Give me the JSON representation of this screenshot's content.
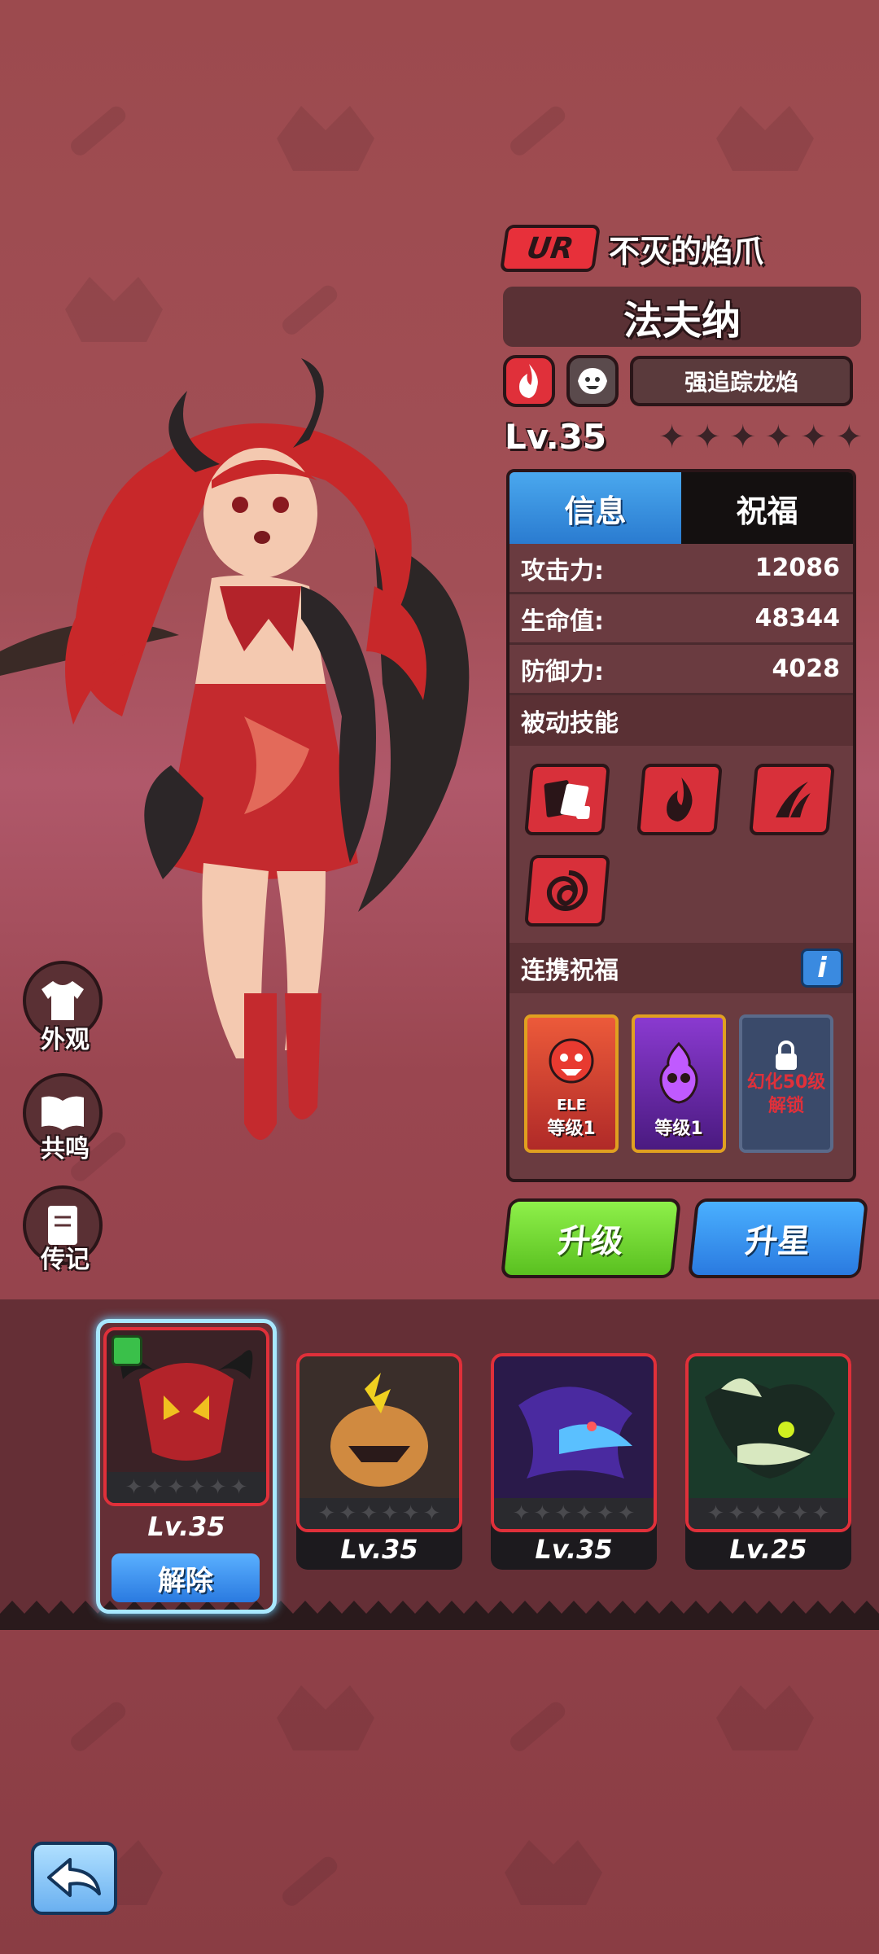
{
  "hero": {
    "rarity": "UR",
    "subtitle": "不灭的焰爪",
    "name": "法夫纳",
    "element_icons": [
      "fire-icon",
      "beast-icon"
    ],
    "trait": "强追踪龙焰",
    "level": "Lv.35",
    "stars_total": 6,
    "stars_filled": 0
  },
  "tabs": {
    "info": "信息",
    "bless": "祝福",
    "active": "info"
  },
  "stats": [
    {
      "label": "攻击力:",
      "value": "12086"
    },
    {
      "label": "生命值:",
      "value": "48344"
    },
    {
      "label": "防御力:",
      "value": "4028"
    }
  ],
  "passive": {
    "title": "被动技能",
    "skills": [
      "cards-dice-icon",
      "flame-icon",
      "claw-slash-icon",
      "swirl-icon"
    ]
  },
  "bond": {
    "title": "连携祝福",
    "info_label": "i",
    "cards": [
      {
        "tag": "ELE",
        "level": "等级1"
      },
      {
        "level": "等级1"
      }
    ],
    "locked": {
      "line1": "幻化50级",
      "line2": "解锁"
    }
  },
  "actions": {
    "upgrade": "升级",
    "star_up": "升星"
  },
  "side_menu": [
    {
      "label": "外观",
      "icon": "shirt-icon"
    },
    {
      "label": "共鸣",
      "icon": "book-icon"
    },
    {
      "label": "传记",
      "icon": "journal-icon"
    }
  ],
  "roster": [
    {
      "level": "Lv.35",
      "selected": true,
      "action": "解除"
    },
    {
      "level": "Lv.35"
    },
    {
      "level": "Lv.35"
    },
    {
      "level": "Lv.25"
    }
  ],
  "colors": {
    "accent_red": "#e0303a",
    "accent_blue": "#2a7ae0",
    "accent_green": "#5ac020"
  }
}
